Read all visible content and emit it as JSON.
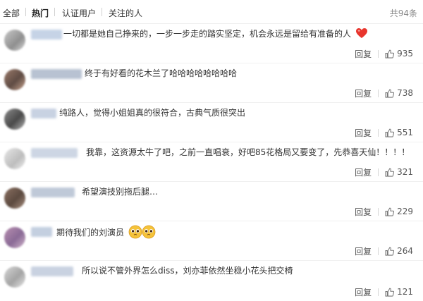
{
  "tabs": {
    "all": "全部",
    "hot": "热门",
    "verified": "认证用户",
    "following": "关注的人"
  },
  "total": "共94条",
  "reply_label": "回复",
  "colors": {
    "emoji_red": "#e8352d",
    "emoji_yellow": "#f5c33a"
  },
  "comments": [
    {
      "text": "一切都是她自己挣来的，一步一步走的踏实坚定，机会永远是留给有准备的人",
      "emoji": "red-heart",
      "likes": "935"
    },
    {
      "text": "终于有好看的花木兰了哈哈哈哈哈哈哈哈",
      "likes": "738"
    },
    {
      "text": "纯路人，觉得小姐姐真的很符合，古典气质很突出",
      "likes": "551"
    },
    {
      "text": "我靠，这资源太牛了吧，之前一直唱衰，好吧85花格局又要变了，先恭喜天仙！！！！",
      "likes": "321"
    },
    {
      "text": "希望演技别拖后腿…",
      "likes": "229"
    },
    {
      "text": "期待我们的刘演员",
      "emoji": "pleading-face",
      "likes": "264"
    },
    {
      "text": "所以说不管外界怎么diss，刘亦菲依然坐稳小花头把交椅",
      "likes": "121"
    }
  ]
}
